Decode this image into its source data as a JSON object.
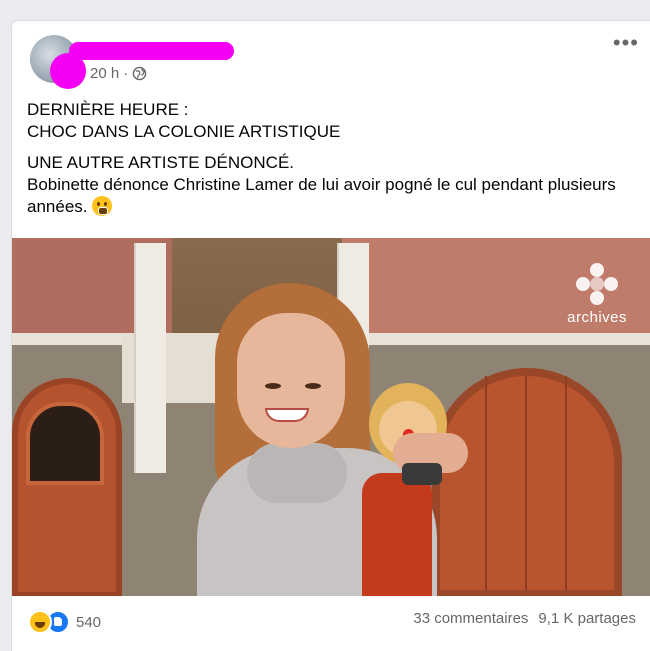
{
  "post": {
    "time": "20 h",
    "separator": "·",
    "visibility_icon": "globe-icon",
    "more_icon": "more-options-icon",
    "text": {
      "line1": "DERNIÈRE HEURE :",
      "line2": "CHOC DANS LA COLONIE ARTISTIQUE",
      "line3": "UNE AUTRE ARTISTE DÉNONCÉ.",
      "line4": "Bobinette dénonce Christine Lamer de lui avoir pogné le cul pendant plusieurs années.",
      "emoji": "face-with-hand-over-mouth"
    },
    "image": {
      "watermark": "archives",
      "logo_icon": "radio-canada-logo"
    }
  },
  "footer": {
    "reaction_icons": [
      "haha-icon",
      "like-icon"
    ],
    "reaction_count": "540",
    "comments": "33 commentaires",
    "shares": "9,1 K partages"
  },
  "colors": {
    "redaction": "#f500f5",
    "meta_text": "#65676b",
    "body_text": "#050505",
    "like_blue": "#1877f2"
  }
}
